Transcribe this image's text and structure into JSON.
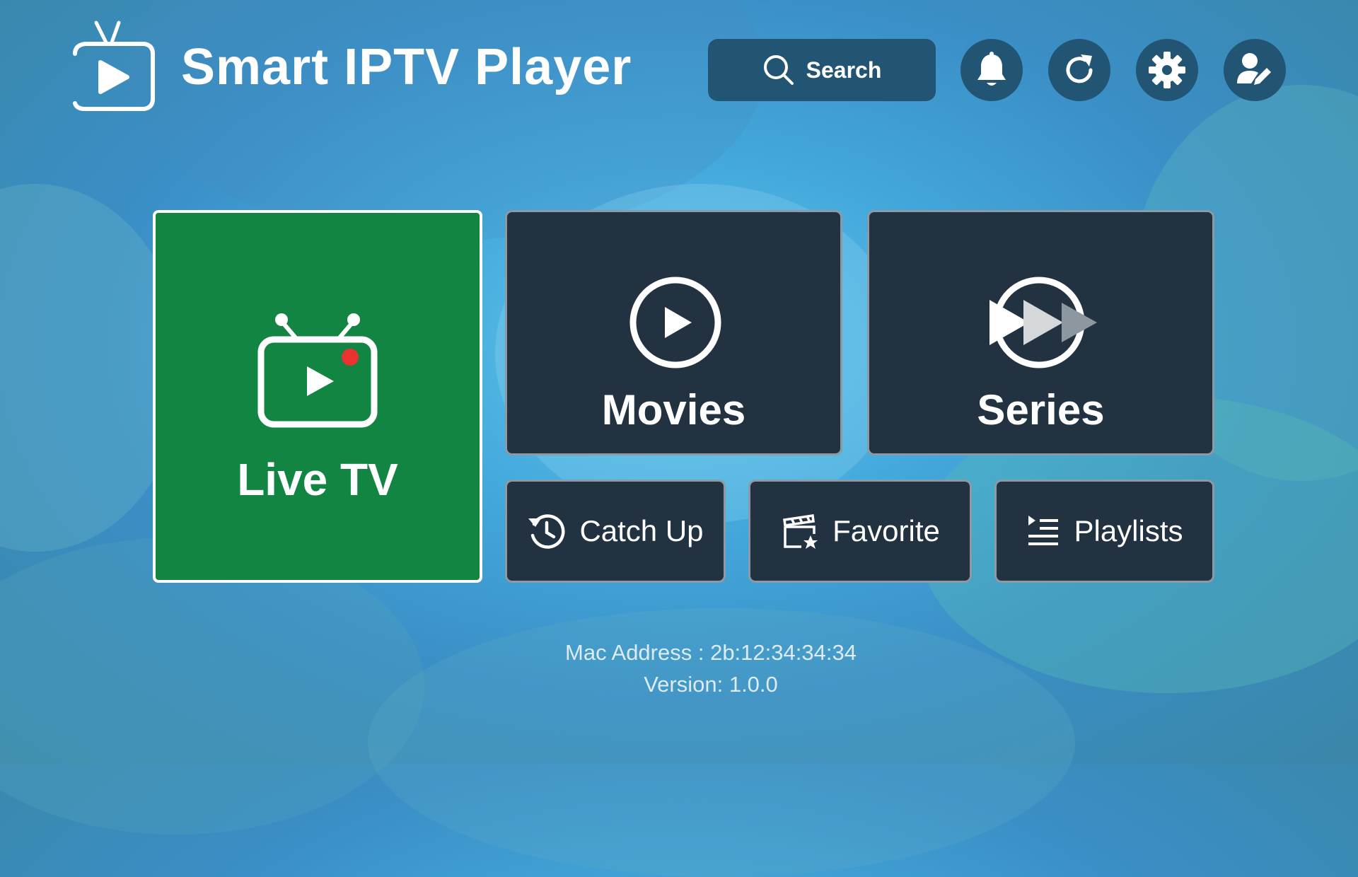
{
  "header": {
    "app_title": "Smart IPTV Player",
    "search_label": "Search",
    "icons": [
      "tv-logo-icon",
      "search-icon",
      "bell-icon",
      "refresh-icon",
      "gear-icon",
      "user-edit-icon"
    ]
  },
  "tiles": {
    "live_tv": {
      "label": "Live TV",
      "icon": "tv-icon"
    },
    "movies": {
      "label": "Movies",
      "icon": "play-circle-icon"
    },
    "series": {
      "label": "Series",
      "icon": "fast-forward-icon"
    },
    "catch_up": {
      "label": "Catch Up",
      "icon": "history-icon"
    },
    "favorite": {
      "label": "Favorite",
      "icon": "clapperboard-star-icon"
    },
    "playlists": {
      "label": "Playlists",
      "icon": "playlist-icon"
    }
  },
  "footer": {
    "mac_address": "Mac Address : 2b:12:34:34:34",
    "version": "Version: 1.0.0"
  },
  "colors": {
    "accent_green": "#138543",
    "tile_dark": "#223241",
    "button_bg": "#225574",
    "red_dot": "#e8332f"
  }
}
